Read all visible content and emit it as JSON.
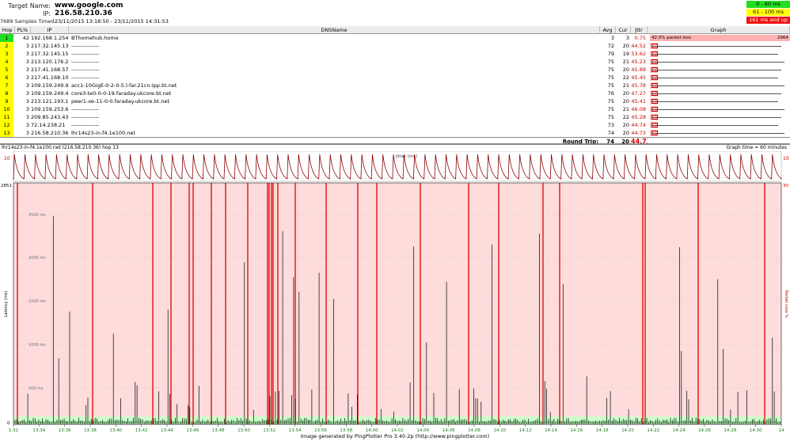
{
  "header": {
    "target_label": "Target Name:",
    "target_value": "www.google.com",
    "ip_label": "IP:",
    "ip_value": "216.58.210.36",
    "samples_label": "7689 Samples Timed:",
    "samples_value": "23/11/2015 13:18:50 - 23/11/2015 14:31:53"
  },
  "legend": [
    {
      "text": "0 - 60 ms",
      "bg": "#22dd22",
      "fg": "#000000"
    },
    {
      "text": "61 - 100 ms",
      "bg": "#ffff00",
      "fg": "#000000"
    },
    {
      "text": "161 ms and up",
      "bg": "#ee1111",
      "fg": "#ffffff"
    }
  ],
  "columns": {
    "hop": "Hop",
    "pl": "PL%",
    "ip": "IP",
    "dns": "DNSName",
    "avg": "Avg",
    "cur": "Cur",
    "jttr": "Jttr",
    "graph": "Graph"
  },
  "hops": [
    {
      "hop": "1",
      "pl": "42",
      "ip": "192.168.1.254",
      "dns": "BThomehub.home",
      "avg": "3",
      "cur": "3",
      "jttr": "0.75",
      "color": "#22dd22"
    },
    {
      "hop": "2",
      "pl": "3",
      "ip": "217.32.145.132",
      "dns": "---------------",
      "avg": "72",
      "cur": "20",
      "jttr": "44.52",
      "color": "#ffff00"
    },
    {
      "hop": "3",
      "pl": "3",
      "ip": "217.32.145.158",
      "dns": "---------------",
      "avg": "79",
      "cur": "19",
      "jttr": "53.62",
      "color": "#ffff00"
    },
    {
      "hop": "4",
      "pl": "3",
      "ip": "213.120.176.2",
      "dns": "---------------",
      "avg": "75",
      "cur": "21",
      "jttr": "45.23",
      "color": "#ffff00"
    },
    {
      "hop": "5",
      "pl": "3",
      "ip": "217.41.168.57",
      "dns": "---------------",
      "avg": "75",
      "cur": "20",
      "jttr": "45.88",
      "color": "#ffff00"
    },
    {
      "hop": "6",
      "pl": "3",
      "ip": "217.41.168.107",
      "dns": "---------------",
      "avg": "75",
      "cur": "22",
      "jttr": "45.45",
      "color": "#ffff00"
    },
    {
      "hop": "7",
      "pl": "3",
      "ip": "109.159.249.99",
      "dns": "acc1-10GigE-0-2-0-5.l-far.21cn-ipp.bt.net",
      "avg": "75",
      "cur": "21",
      "jttr": "45.78",
      "color": "#ffff00"
    },
    {
      "hop": "8",
      "pl": "3",
      "ip": "109.159.249.43",
      "dns": "core3-te0-0-0-19.faraday.ukcore.bt.net",
      "avg": "76",
      "cur": "20",
      "jttr": "47.27",
      "color": "#ffff00"
    },
    {
      "hop": "9",
      "pl": "3",
      "ip": "213.121.193.169",
      "dns": "peer1-xe-11-0-0.faraday.ukcore.bt.net",
      "avg": "75",
      "cur": "20",
      "jttr": "45.41",
      "color": "#ffff00"
    },
    {
      "hop": "10",
      "pl": "3",
      "ip": "109.159.253.67",
      "dns": "---------------",
      "avg": "75",
      "cur": "21",
      "jttr": "46.08",
      "color": "#ffff00"
    },
    {
      "hop": "11",
      "pl": "3",
      "ip": "209.85.243.43",
      "dns": "---------------",
      "avg": "75",
      "cur": "22",
      "jttr": "45.28",
      "color": "#ffff00"
    },
    {
      "hop": "12",
      "pl": "3",
      "ip": "72.14.238.21",
      "dns": "---------------",
      "avg": "73",
      "cur": "20",
      "jttr": "44.74",
      "color": "#ffff00"
    },
    {
      "hop": "13",
      "pl": "3",
      "ip": "216.58.210.36",
      "dns": "lhr14s23-in-f4.1e100.net",
      "avg": "74",
      "cur": "20",
      "jttr": "44.73",
      "color": "#ffff00"
    }
  ],
  "roundtrip": {
    "label": "Round Trip:",
    "avg": "74",
    "cur": "20",
    "jttr": "44.73"
  },
  "hop1_graph_label": "42.0% packet loss",
  "hop1_graph_max": "2964",
  "graph": {
    "title": "lhr14s23-in-f4.1e100.net (216.58.210.36) hop 13",
    "time_label": "Graph time = 60 minutes",
    "jitter_label": "Jitter (ms)",
    "jitter_scale_left": "10",
    "jitter_scale_right": "10",
    "latency_axis_label": "Latency (ms)",
    "packetloss_axis_label": "Packet Loss %",
    "latency_max_label": "2851",
    "pl_max_label": "30",
    "zero_label": "0",
    "y_ticks": [
      "2500 ms",
      "2000 ms",
      "1500 ms",
      "1000 ms",
      "500 ms"
    ],
    "x_ticks": [
      "1:32",
      "13:34",
      "13:36",
      "13:38",
      "13:40",
      "13:42",
      "13:44",
      "13:46",
      "13:48",
      "13:50",
      "13:52",
      "13:54",
      "13:56",
      "13:58",
      "14:00",
      "14:02",
      "14:04",
      "14:06",
      "14:08",
      "14:10",
      "14:12",
      "14:14",
      "14:16",
      "14:18",
      "14:20",
      "14:22",
      "14:24",
      "14:26",
      "14:28",
      "14:30",
      "14"
    ]
  },
  "footer": "Image generated by PingPlotter Pro 3.40.2p (http://www.pingplotter.com)",
  "colors": {
    "loss_fill": "#ffdcdc",
    "loss_line": "#e00000",
    "jitter": "#8b0000",
    "latency": "#000000",
    "good_band": "#ccffcc"
  }
}
